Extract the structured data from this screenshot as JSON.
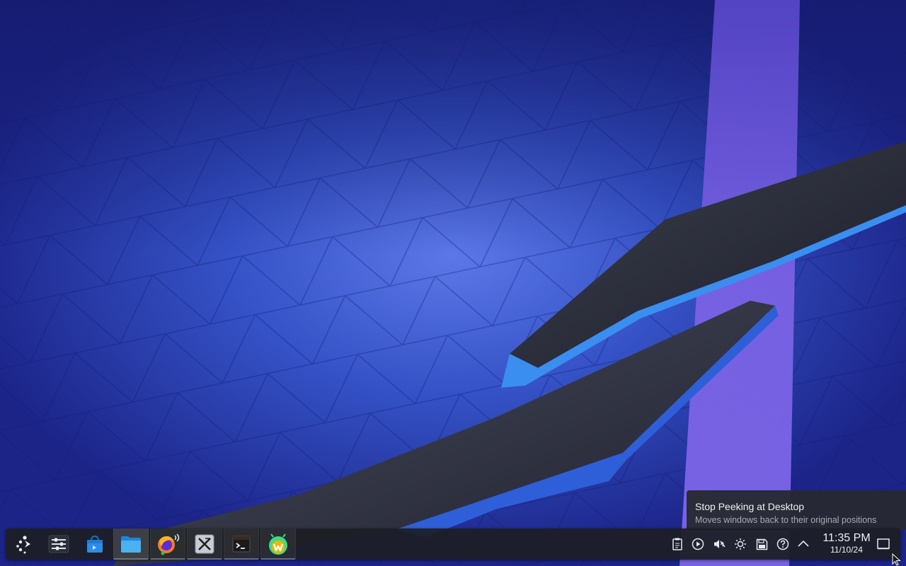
{
  "desktop": {
    "wallpaper": "plasma-default-blue"
  },
  "panel": {
    "launcher": {
      "icon": "application-launcher-icon"
    },
    "tasks": [
      {
        "name": "system-settings",
        "icon": "sliders-icon",
        "state": "pinned"
      },
      {
        "name": "discover-store",
        "icon": "store-bag-icon",
        "state": "pinned"
      },
      {
        "name": "file-manager",
        "icon": "folder-icon",
        "state": "running"
      },
      {
        "name": "firefox",
        "icon": "firefox-icon",
        "state": "running",
        "badge": "audio-playing"
      },
      {
        "name": "x-app",
        "icon": "x-app-icon",
        "state": "running"
      },
      {
        "name": "terminal",
        "icon": "terminal-icon",
        "state": "running"
      },
      {
        "name": "android-app",
        "icon": "android-w-icon",
        "state": "running"
      }
    ]
  },
  "tray": {
    "icons": [
      "clipboard-icon",
      "media-player-icon",
      "volume-muted-icon",
      "brightness-icon",
      "save-disk-icon",
      "help-icon",
      "expand-tray-icon"
    ],
    "clock": {
      "time": "11:35 PM",
      "date": "11/10/24"
    },
    "peek_icon": "show-desktop-icon"
  },
  "tooltip": {
    "title": "Stop Peeking at Desktop",
    "subtitle": "Moves windows back to their original positions"
  },
  "colors": {
    "panel_bg": "#1c1e24",
    "accent": "#3daee9",
    "text": "#eef0f2"
  }
}
